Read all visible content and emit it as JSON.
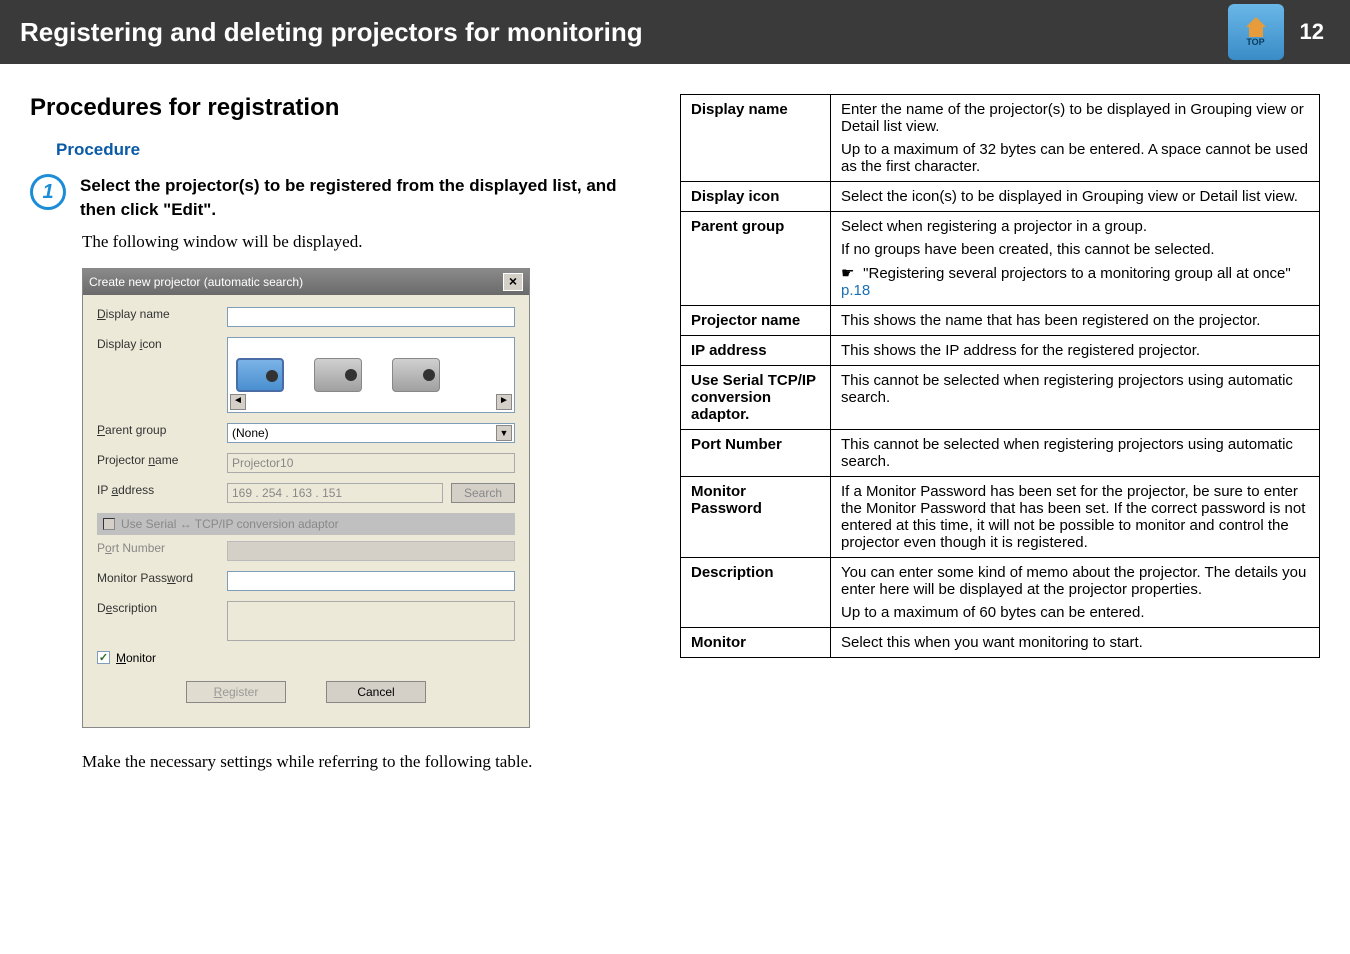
{
  "header": {
    "title": "Registering and deleting projectors for monitoring",
    "page_num": "12",
    "top_label": "TOP"
  },
  "left": {
    "h2": "Procedures for registration",
    "procedure_label": "Procedure",
    "step1_num": "1",
    "step1_text": "Select the projector(s) to be registered from the displayed list, and then click \"Edit\".",
    "following": "The following window will be displayed.",
    "note": "Make the necessary settings while referring to the following table."
  },
  "dialog": {
    "title": "Create new projector (automatic search)",
    "labels": {
      "display_name": "Display name",
      "display_icon": "Display icon",
      "parent_group": "Parent group",
      "projector_name": "Projector name",
      "ip_address": "IP address",
      "use_serial": "Use Serial ↔ TCP/IP conversion adaptor",
      "port_number": "Port Number",
      "monitor_password": "Monitor Password",
      "description": "Description",
      "monitor": "Monitor"
    },
    "values": {
      "parent_group": "(None)",
      "projector_name": "Projector10",
      "ip": "169 . 254 . 163 . 151"
    },
    "buttons": {
      "search": "Search",
      "register": "Register",
      "cancel": "Cancel"
    }
  },
  "table": {
    "rows": {
      "display_name": {
        "label": "Display name",
        "p1": "Enter the name of the projector(s) to be displayed in Grouping view or Detail list view.",
        "p2": "Up to a maximum of 32 bytes can be entered. A space cannot be used as the first character."
      },
      "display_icon": {
        "label": "Display icon",
        "p1": "Select the icon(s) to be displayed in Grouping view or Detail list view."
      },
      "parent_group": {
        "label": "Parent group",
        "p1": "Select when registering a projector in a group.",
        "p2": "If no groups have been created, this cannot be selected.",
        "p3a": "\"Registering several projectors to a monitoring group all at once\"",
        "p3b": "p.18"
      },
      "projector_name": {
        "label": "Projector name",
        "p1": "This shows the name that has been registered on the projector."
      },
      "ip_address": {
        "label": "IP address",
        "p1": "This shows the IP address for the registered projector."
      },
      "use_serial": {
        "label": "Use Serial TCP/IP conversion adaptor.",
        "p1": "This cannot be selected when registering projectors using automatic search."
      },
      "port_number": {
        "label": "Port Number",
        "p1": "This cannot be selected when registering projectors using automatic search."
      },
      "monitor_password": {
        "label": "Monitor Password",
        "p1": "If a Monitor Password has been set for the projector, be sure to enter the Monitor Password that has been set. If the correct password is not entered at this time, it will not be possible to monitor and control the projector even though it is registered."
      },
      "description": {
        "label": "Description",
        "p1": "You can enter some kind of memo about the projector. The details you enter here will be displayed at the projector properties.",
        "p2": "Up to a maximum of 60 bytes can be entered."
      },
      "monitor": {
        "label": "Monitor",
        "p1": "Select this when you want monitoring to start."
      }
    }
  }
}
